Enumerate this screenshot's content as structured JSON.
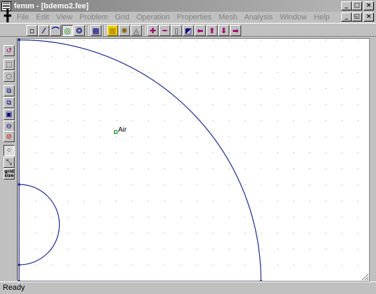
{
  "window": {
    "title": "femm - [bdemo2.fee]"
  },
  "window_buttons": {
    "minimize": "_",
    "maximize": "□",
    "close": "×"
  },
  "menu": {
    "system_glyph": "╋",
    "items": [
      "File",
      "Edit",
      "View",
      "Problem",
      "Grid",
      "Operation",
      "Properties",
      "Mesh",
      "Analysis",
      "Window",
      "Help"
    ]
  },
  "mdi_buttons": {
    "minimize": "_",
    "restore": "◱",
    "close": "×"
  },
  "toolbar": {
    "tools": [
      {
        "icon": "node-mode-icon",
        "glyph": "▫",
        "pressed": false
      },
      {
        "icon": "segment-mode-icon",
        "glyph": "⁄",
        "pressed": false
      },
      {
        "icon": "arc-segment-mode-icon",
        "glyph": "⌒",
        "pressed": false
      },
      {
        "icon": "block-label-mode-icon",
        "glyph": "◎",
        "pressed": true
      },
      {
        "icon": "group-mode-icon",
        "glyph": "❂",
        "pressed": false
      },
      {
        "icon": "property-table-icon",
        "glyph": "▦",
        "pressed": false
      },
      {
        "icon": "mesh-icon",
        "glyph": "▩",
        "pressed": false
      },
      {
        "icon": "analyze-icon",
        "glyph": "✺",
        "pressed": false
      },
      {
        "icon": "view-results-icon",
        "glyph": "◬",
        "pressed": false
      },
      {
        "icon": "zoom-in-icon",
        "glyph": "✚",
        "pressed": false
      },
      {
        "icon": "zoom-out-icon",
        "glyph": "━",
        "pressed": false
      },
      {
        "icon": "zoom-page-icon",
        "glyph": "▯",
        "pressed": false
      },
      {
        "icon": "zoom-window-icon",
        "glyph": "◩",
        "pressed": false
      },
      {
        "icon": "pan-left-icon",
        "glyph": "⬅",
        "pressed": false
      },
      {
        "icon": "pan-up-icon",
        "glyph": "⬆",
        "pressed": false
      },
      {
        "icon": "pan-down-icon",
        "glyph": "⬇",
        "pressed": false
      },
      {
        "icon": "pan-right-icon",
        "glyph": "➡",
        "pressed": false
      }
    ]
  },
  "left_toolbar": {
    "tools": [
      {
        "icon": "undo-icon",
        "glyph": "↺"
      },
      {
        "icon": "select-window-icon",
        "glyph": "⬚"
      },
      {
        "icon": "select-circle-icon",
        "glyph": "◌"
      },
      {
        "icon": "move-icon",
        "glyph": "⧉"
      },
      {
        "icon": "copy-icon",
        "glyph": "⧉"
      },
      {
        "icon": "scale-icon",
        "glyph": "▣"
      },
      {
        "icon": "mirror-icon",
        "glyph": "⊖"
      },
      {
        "icon": "delete-icon",
        "glyph": "⊘"
      },
      {
        "icon": "show-grid-icon",
        "glyph": "⁘",
        "pressed": true
      },
      {
        "icon": "snap-grid-icon",
        "glyph": "⤡"
      },
      {
        "icon": "grid-size-icon",
        "text1": "grid",
        "text2": "size"
      }
    ]
  },
  "drawing": {
    "block_label": "Air"
  },
  "colors": {
    "geometry": "#1c2a8c",
    "label_node": "#008000",
    "grid_dot": "#909090"
  },
  "status": {
    "text": "Ready"
  }
}
